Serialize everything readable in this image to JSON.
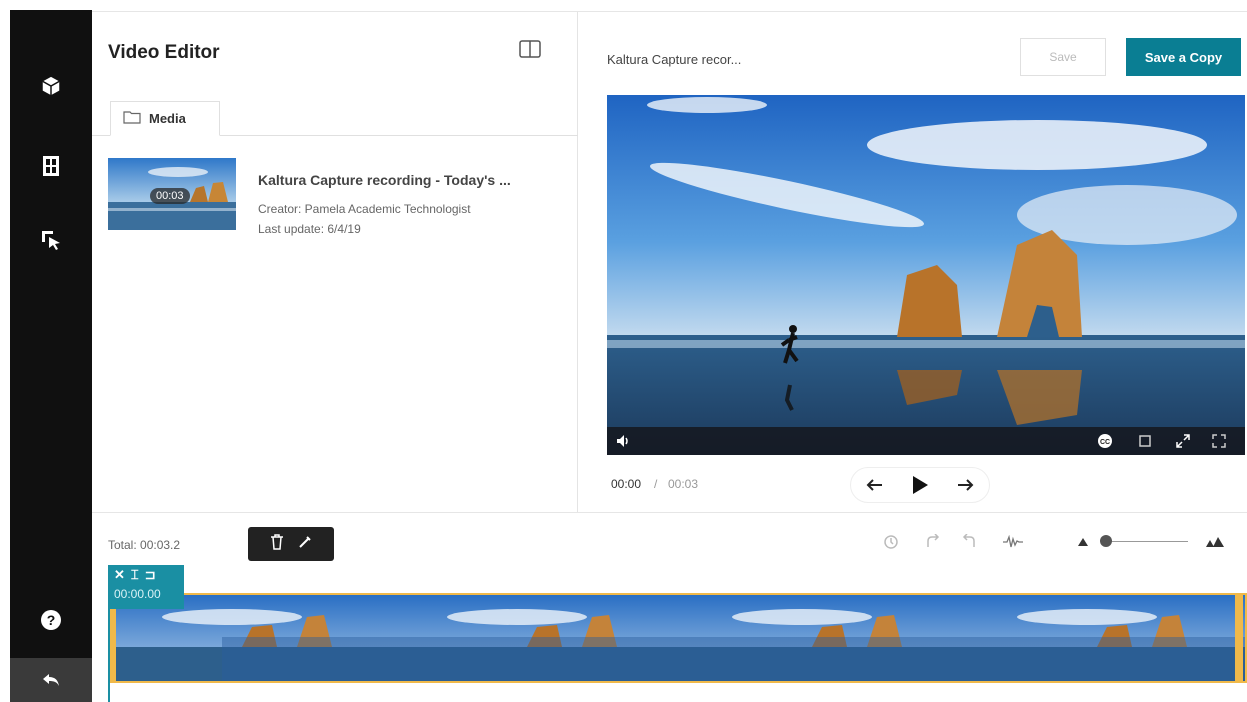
{
  "sidebar": {
    "icons": [
      "cube-icon",
      "film-icon",
      "pointer-icon"
    ],
    "help_icon": "help-icon",
    "back_icon": "back-icon"
  },
  "editor": {
    "title": "Video Editor",
    "tab_media": "Media"
  },
  "media": {
    "title": "Kaltura Capture recording - Today's ...",
    "creator": "Creator: Pamela Academic Technologist",
    "last_update": "Last update: 6/4/19",
    "duration_badge": "00:03"
  },
  "player": {
    "title": "Kaltura Capture recor...",
    "save_label": "Save",
    "save_copy_label": "Save a Copy",
    "time_current": "00:00",
    "time_separator": "/",
    "time_total": "00:03"
  },
  "timeline": {
    "total_label": "Total: 00:03.2",
    "clip_time": "00:00.00"
  },
  "colors": {
    "accent": "#0a7e93",
    "clip_accent": "#1a8fa3",
    "strip_border": "#f0b94a",
    "sidebar": "#101010"
  }
}
